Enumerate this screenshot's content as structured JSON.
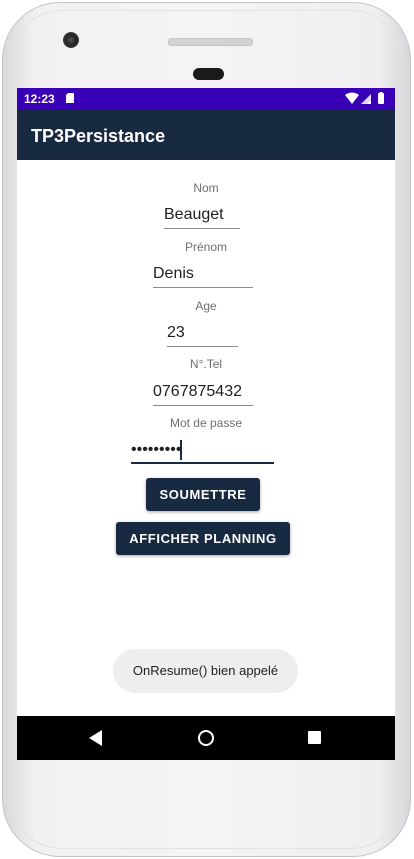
{
  "status_bar": {
    "time": "12:23"
  },
  "app_bar": {
    "title": "TP3Persistance"
  },
  "form": {
    "nom": {
      "label": "Nom",
      "value": "Beauget"
    },
    "prenom": {
      "label": "Prénom",
      "value": "Denis"
    },
    "age": {
      "label": "Age",
      "value": "23"
    },
    "tel": {
      "label": "N°.Tel",
      "value": "0767875432"
    },
    "password": {
      "label": "Mot de passe",
      "value": "•••••••••"
    }
  },
  "buttons": {
    "submit_label": "SOUMETTRE",
    "planning_label": "AFFICHER PLANNING"
  },
  "toast": {
    "message": "OnResume() bien appelé"
  },
  "colors": {
    "status_bar": "#3a00b8",
    "app_bar": "#172a42",
    "button": "#172a42"
  },
  "icons": {
    "status": [
      "sd-card-icon",
      "wifi-icon",
      "signal-icon",
      "battery-icon"
    ],
    "navigation": [
      "back-icon",
      "home-icon",
      "recents-icon"
    ]
  }
}
